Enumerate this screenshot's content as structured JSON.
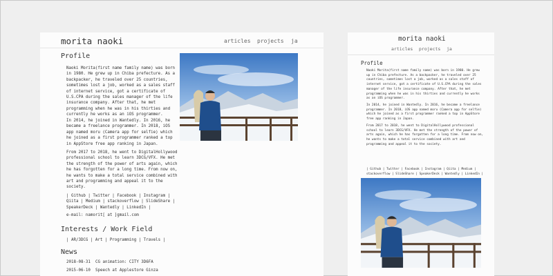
{
  "site": {
    "title": "morita naoki"
  },
  "nav": [
    {
      "label": "articles"
    },
    {
      "label": "projects"
    },
    {
      "label": "ja"
    }
  ],
  "profile": {
    "heading": "Profile",
    "paragraphs": [
      "Naoki Morita(first name family name) was born in 1980. He grew up in Chiba prefecture. As a backpacker, he traveled over 25 countries, sometimes lost a job, worked as a sales staff of internet service, got a certificate of U.S.CPA during the sales manager of the life insurance company. After that, he met programming when he was in his thirties and currently he works as an iOS programmer.",
      "In 2014, he joined in Wantedly. In 2016, he became a freelance programmer. In 2018, iOS app named moru (Camera app for selfie) which he joined as a first programmer ranked a top in AppStore free app ranking in Japan.",
      "From 2017 to 2018, he went to DigitalHollywood professional school to learn 3DCG/VFX. He met the strength of the power of arts again, which he has forgotten for a long time. From now on, he wants to make a total service combined with art and programming and appeal it to the society."
    ],
    "links": "| Github | Twitter | Facebook | Instagram | Qiita | Medium | stackoverflow | SlideShare | SpeakerDeck | Wantedly | LinkedIn |",
    "email": "e-mail: namorit[ at ]gmail.com"
  },
  "interests": {
    "heading": "Interests / Work Field",
    "items": "| AR/3DCG | Art | Programming | Travels |"
  },
  "news": {
    "heading": "News",
    "items": [
      {
        "date": "2018-08-31",
        "text": "CG animation: CITY 3D6FA"
      },
      {
        "date": "2015-06-10",
        "text": "Speech at Applestore Ginza"
      }
    ]
  },
  "colors": {
    "background": "#efefef",
    "page": "#fcfcfc",
    "text": "#333333",
    "nav": "#666666",
    "sky": "#4f86c9"
  },
  "photo": {
    "subject": "person-in-blue-jacket-on-mountain-balcony"
  }
}
